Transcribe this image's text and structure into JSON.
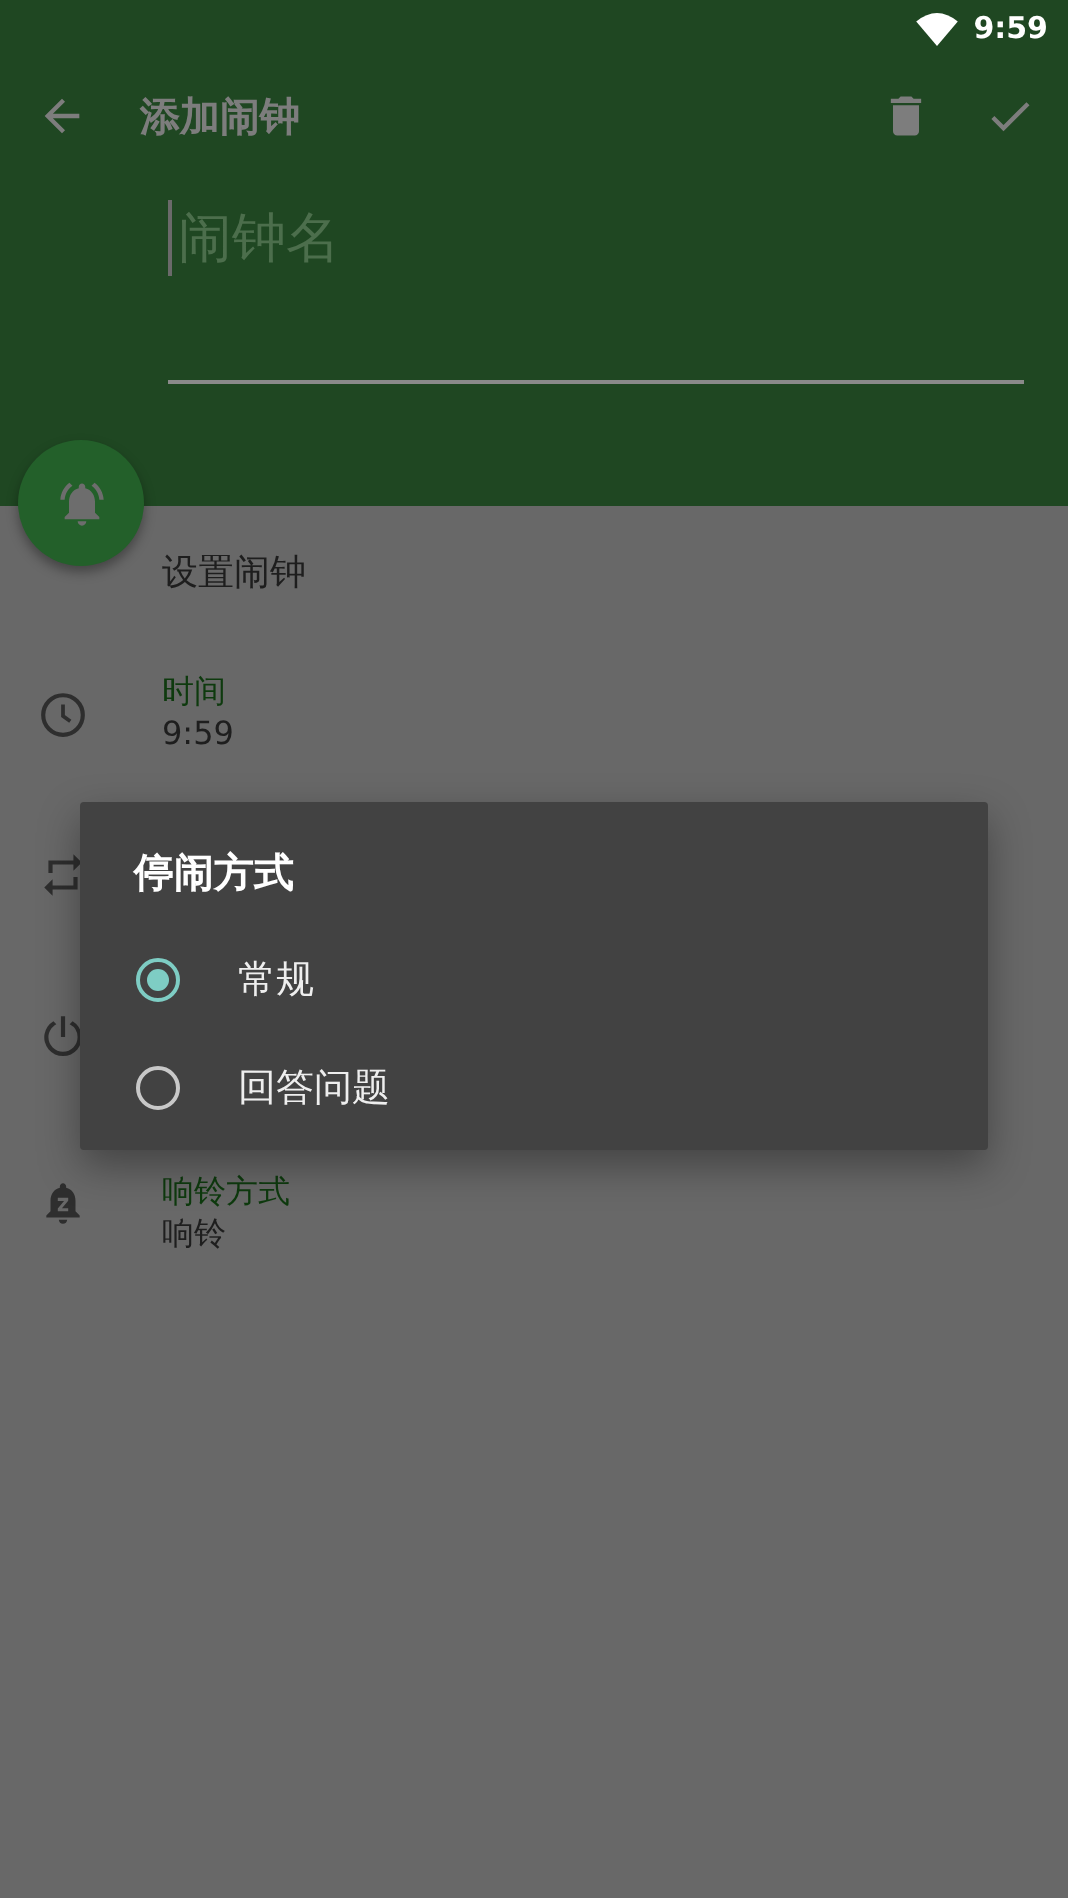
{
  "status_bar": {
    "time": "9:59"
  },
  "toolbar": {
    "title": "添加闹钟"
  },
  "name_field": {
    "placeholder": "闹钟名"
  },
  "section_title": "设置闹钟",
  "settings": [
    {
      "kind": "time",
      "label": "时间",
      "value": "9:59"
    },
    {
      "kind": "repeat"
    },
    {
      "kind": "power"
    },
    {
      "kind": "ringtone",
      "label": "响铃方式",
      "value": "响铃"
    }
  ],
  "dialog": {
    "title": "停闹方式",
    "options": [
      {
        "label": "常规",
        "selected": true
      },
      {
        "label": "回答问题",
        "selected": false
      }
    ]
  }
}
